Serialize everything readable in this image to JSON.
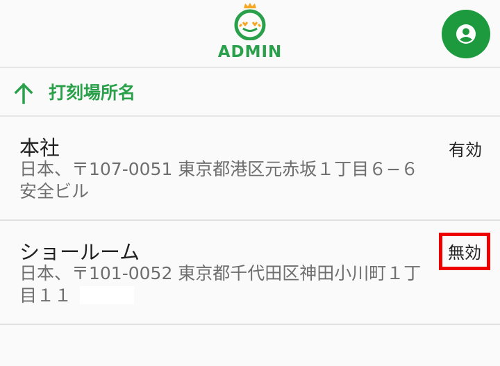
{
  "header": {
    "logo_text": "ADMIN",
    "brand_color": "#2aa04a",
    "account_icon": "account-circle-icon"
  },
  "section": {
    "title": "打刻場所名",
    "back_icon": "arrow-up-icon"
  },
  "locations": [
    {
      "name": "本社",
      "address": "日本、〒107-0051 東京都港区元赤坂１丁目６−６ 安全ビル",
      "status": "有効"
    },
    {
      "name": "ショールーム",
      "address": "日本、〒101-0052 東京都千代田区神田小川町１丁目１１",
      "status": "無効",
      "status_highlight_color": "#ee0000"
    }
  ]
}
